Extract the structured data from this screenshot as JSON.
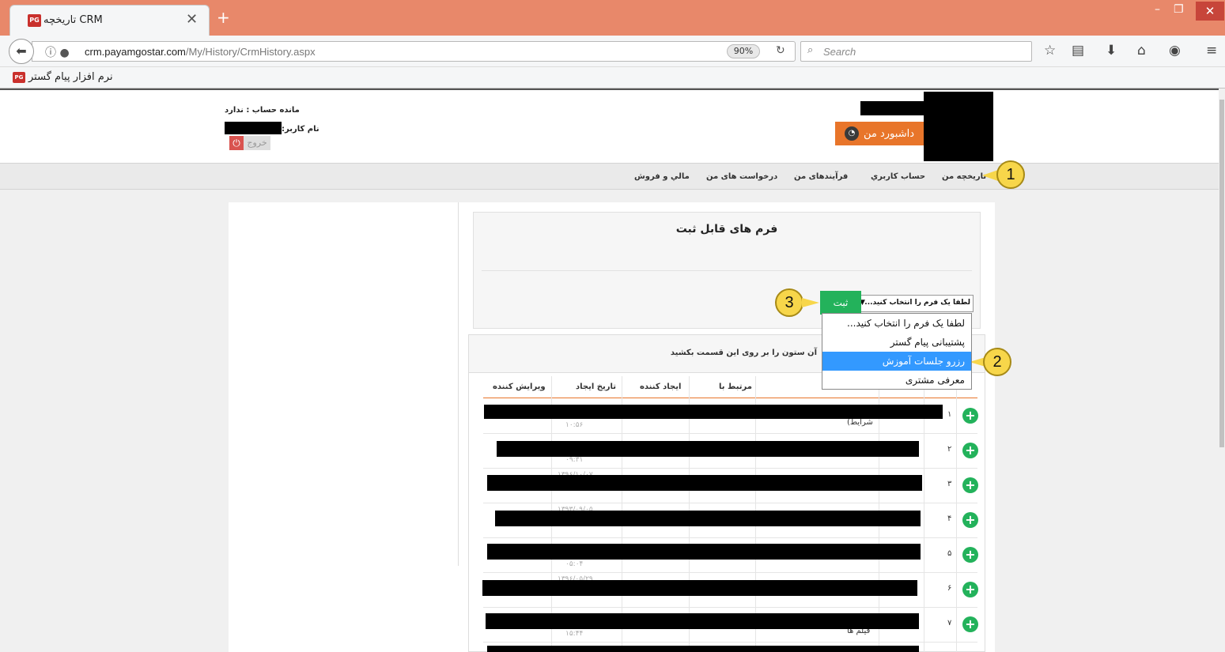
{
  "browser": {
    "tab_title": "CRM تاریخچه",
    "favicon_text": "PG",
    "url_host": "crm.payamgostar.com",
    "url_path": "/My/History/CrmHistory.aspx",
    "zoom": "90%",
    "search_placeholder": "Search",
    "bookmark_label": "نرم افزار پیام گستر"
  },
  "header": {
    "account_balance": "مانده حساب : ندارد",
    "username_label": "نام کاربر:",
    "logout_label": "خروج",
    "dashboard_label": "داشبورد من"
  },
  "menu": {
    "items": [
      "تاریخچه من",
      "حساب کاربري",
      "فرآیندهای من",
      "درخواست های من",
      "مالي و فروش"
    ]
  },
  "annotations": {
    "one": "1",
    "two": "2",
    "three": "3"
  },
  "forms": {
    "title": "فرم های قابل ثبت",
    "select_value": "لطفا یک فرم را انتخاب کنید...",
    "submit_label": "ثبت",
    "options": [
      "لطفا یک فرم را انتخاب کنید...",
      "پشتیبانی پیام گستر",
      "رزرو جلسات آموزش",
      "معرفی مشتری"
    ],
    "selected_index": 2
  },
  "grid": {
    "group_hint": "آن ستون را بر روی این قسمت بکشید",
    "columns": [
      "ویرایش کننده",
      "تاریخ ایجاد",
      "ایجاد کننده",
      "مرتبط با"
    ],
    "rows": [
      {
        "num": "۱",
        "time": "۱۰:۵۶",
        "date": "",
        "extra": "شرایط)"
      },
      {
        "num": "۲",
        "time": "۰۹:۳۱",
        "date": "",
        "extra": ""
      },
      {
        "num": "۳",
        "time": "",
        "date": "۱۳۹۶/۱۰/۰۷",
        "extra": ""
      },
      {
        "num": "۴",
        "time": "",
        "date": "۱۳۹۳/۰۹/۰۵",
        "extra": ""
      },
      {
        "num": "۵",
        "time": "۰۵:۰۴",
        "date": "",
        "extra": ""
      },
      {
        "num": "۶",
        "time": "",
        "date": "۱۳۹۶/۰۵/۲۹",
        "extra": ""
      },
      {
        "num": "۷",
        "time": "۱۵:۴۴",
        "date": "",
        "extra": "فیلم ها"
      }
    ]
  },
  "colors": {
    "accent": "#e8752a",
    "green": "#23b25b",
    "highlight": "#3399ff",
    "callout": "#f7d64a"
  }
}
